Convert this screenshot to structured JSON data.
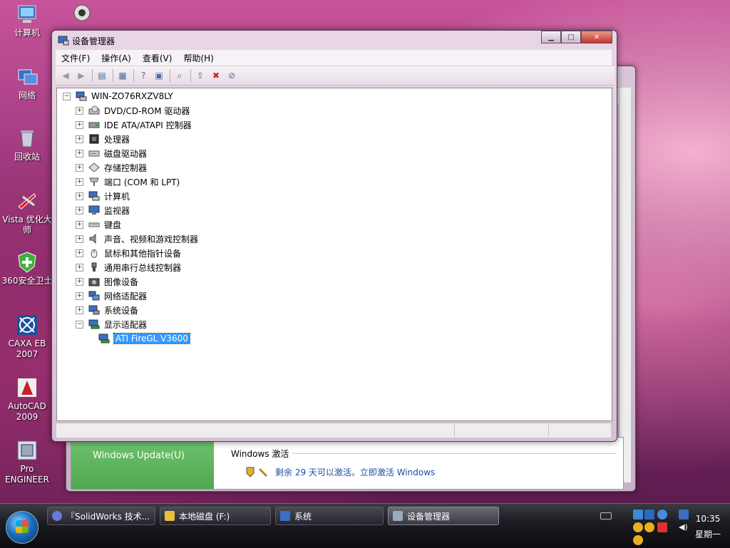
{
  "desktop": {
    "icons": [
      {
        "label": "计算机"
      },
      {
        "label": "网络"
      },
      {
        "label": "回收站"
      },
      {
        "label": "Vista 优化大师"
      },
      {
        "label": "360安全卫士"
      },
      {
        "label": "CAXA EB 2007"
      },
      {
        "label": "AutoCAD 2009"
      },
      {
        "label": "Pro ENGINEER"
      }
    ]
  },
  "background_window": {
    "windows_update": "Windows Update(U)",
    "activation_heading": "Windows 激活",
    "activation_link": "剩余 29 天可以激活。立即激活 Windows"
  },
  "device_manager": {
    "title": "设备管理器",
    "menu": [
      "文件(F)",
      "操作(A)",
      "查看(V)",
      "帮助(H)"
    ],
    "root": "WIN-ZO76RXZV8LY",
    "categories": [
      "DVD/CD-ROM 驱动器",
      "IDE ATA/ATAPI 控制器",
      "处理器",
      "磁盘驱动器",
      "存储控制器",
      "端口 (COM 和 LPT)",
      "计算机",
      "监视器",
      "键盘",
      "声音、视频和游戏控制器",
      "鼠标和其他指针设备",
      "通用串行总线控制器",
      "图像设备",
      "网络适配器",
      "系统设备",
      "显示适配器"
    ],
    "expanded_child": "ATI FireGL V3600"
  },
  "taskbar": {
    "tasks": [
      {
        "label": "『SolidWorks 技术..."
      },
      {
        "label": "本地磁盘 (F:)"
      },
      {
        "label": "系统"
      },
      {
        "label": "设备管理器"
      }
    ],
    "clock_time": "10:35",
    "clock_day": "星期一"
  },
  "colors": {
    "selection": "#3399ff",
    "start_orb": "#1b6ec2",
    "close_button": "#c3352a"
  }
}
